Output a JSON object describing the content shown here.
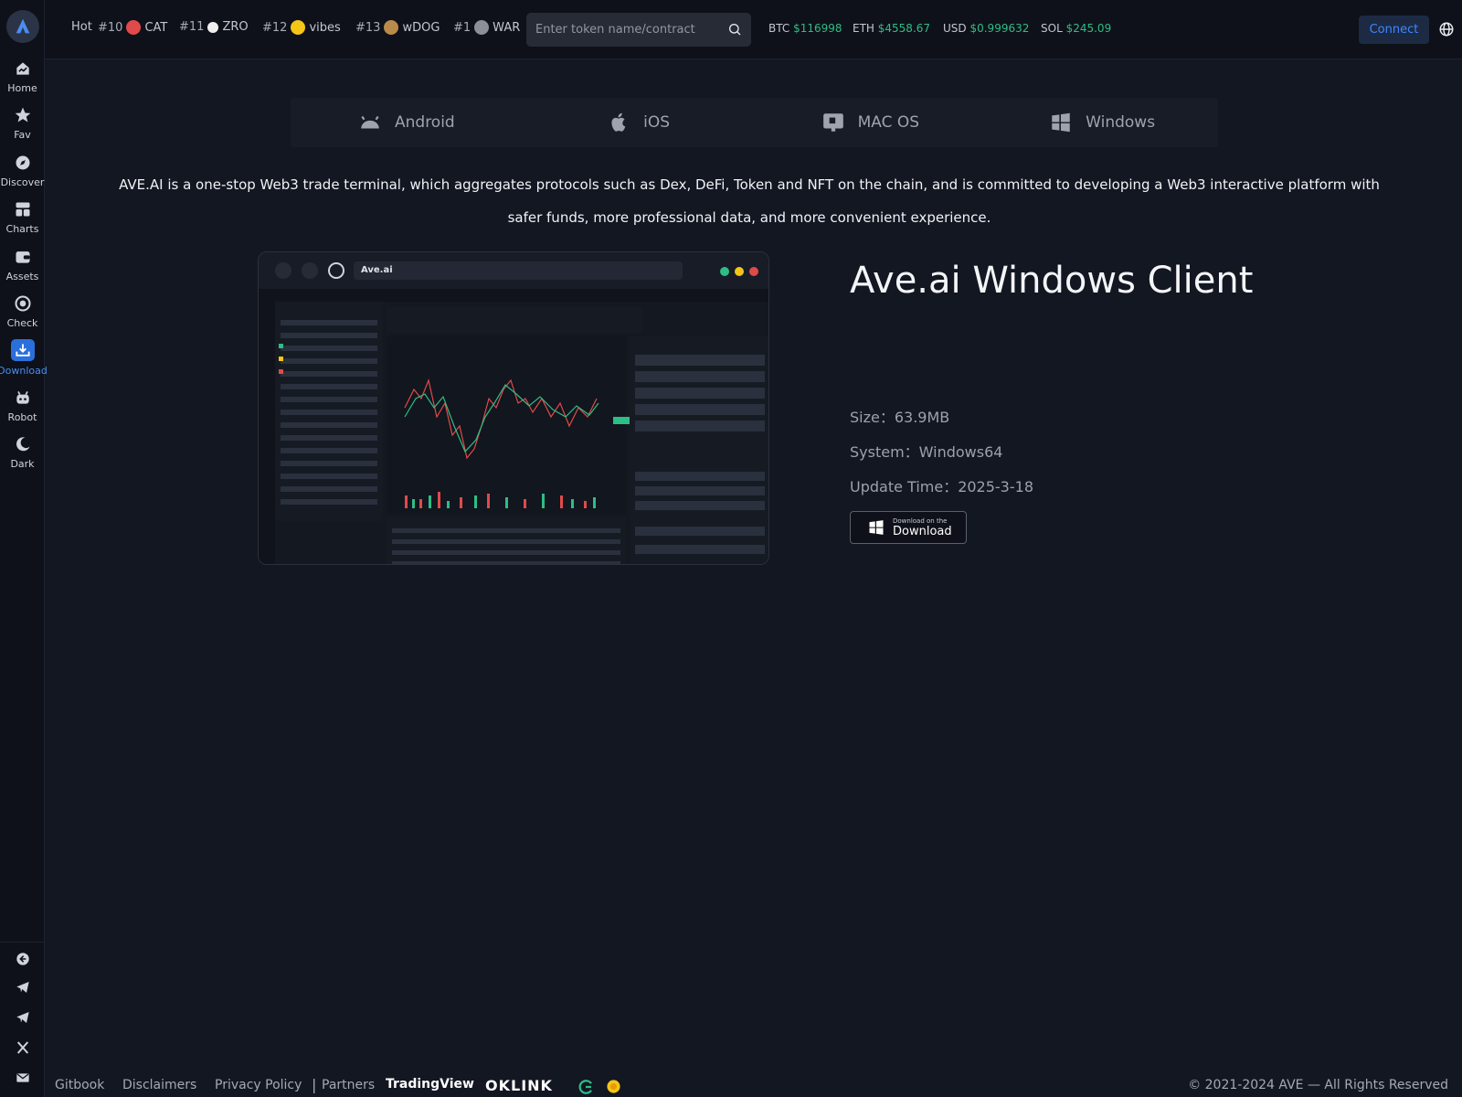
{
  "sidebar": {
    "items": [
      {
        "label": "Home"
      },
      {
        "label": "Fav"
      },
      {
        "label": "Discover"
      },
      {
        "label": "Charts"
      },
      {
        "label": "Assets"
      },
      {
        "label": "Check"
      },
      {
        "label": "Download"
      },
      {
        "label": "Robot"
      },
      {
        "label": "Dark"
      }
    ],
    "active": "Download"
  },
  "topbar": {
    "hot_label": "Hot",
    "tickers": [
      {
        "rank": "#10",
        "symbol": "CAT"
      },
      {
        "rank": "#11",
        "symbol": "ZRO"
      },
      {
        "rank": "#12",
        "symbol": "vibes"
      },
      {
        "rank": "#13",
        "symbol": "wDOG"
      },
      {
        "rank": "#1",
        "symbol": "WAR"
      }
    ],
    "search_placeholder": "Enter token name/contract",
    "prices": [
      {
        "symbol": "BTC",
        "value": "$116998"
      },
      {
        "symbol": "ETH",
        "value": "$4558.67"
      },
      {
        "symbol": "USD",
        "value": "$0.999632"
      },
      {
        "symbol": "SOL",
        "value": "$245.09"
      }
    ],
    "connect_label": "Connect"
  },
  "platforms": [
    {
      "label": "Android"
    },
    {
      "label": "iOS"
    },
    {
      "label": "MAC OS"
    },
    {
      "label": "Windows"
    }
  ],
  "description": "AVE.AI is a one-stop Web3 trade terminal, which aggregates protocols such as Dex, DeFi, Token and NFT on the chain, and is committed to developing a Web3 interactive platform with safer funds, more professional data, and more convenient experience.",
  "preview": {
    "url": "Ave.ai"
  },
  "client": {
    "title": "Ave.ai Windows Client",
    "size": "Size：63.9MB",
    "system": "System：Windows64",
    "update_time": "Update Time：2025-3-18",
    "download_small": "Download on the",
    "download_big": "Download"
  },
  "footer": {
    "links": [
      "Gitbook",
      "Disclaimers",
      "Privacy Policy"
    ],
    "separator": "|",
    "partners_label": "Partners",
    "brands": [
      "TradingView",
      "OKLINK"
    ],
    "copyright": "© 2021-2024 AVE — All Rights Reserved"
  },
  "colors": {
    "background": "#121722",
    "sidebar": "#0e1119",
    "accent": "#2a6fdb",
    "positive": "#2ebd85",
    "connect_text": "#3d87ff"
  }
}
